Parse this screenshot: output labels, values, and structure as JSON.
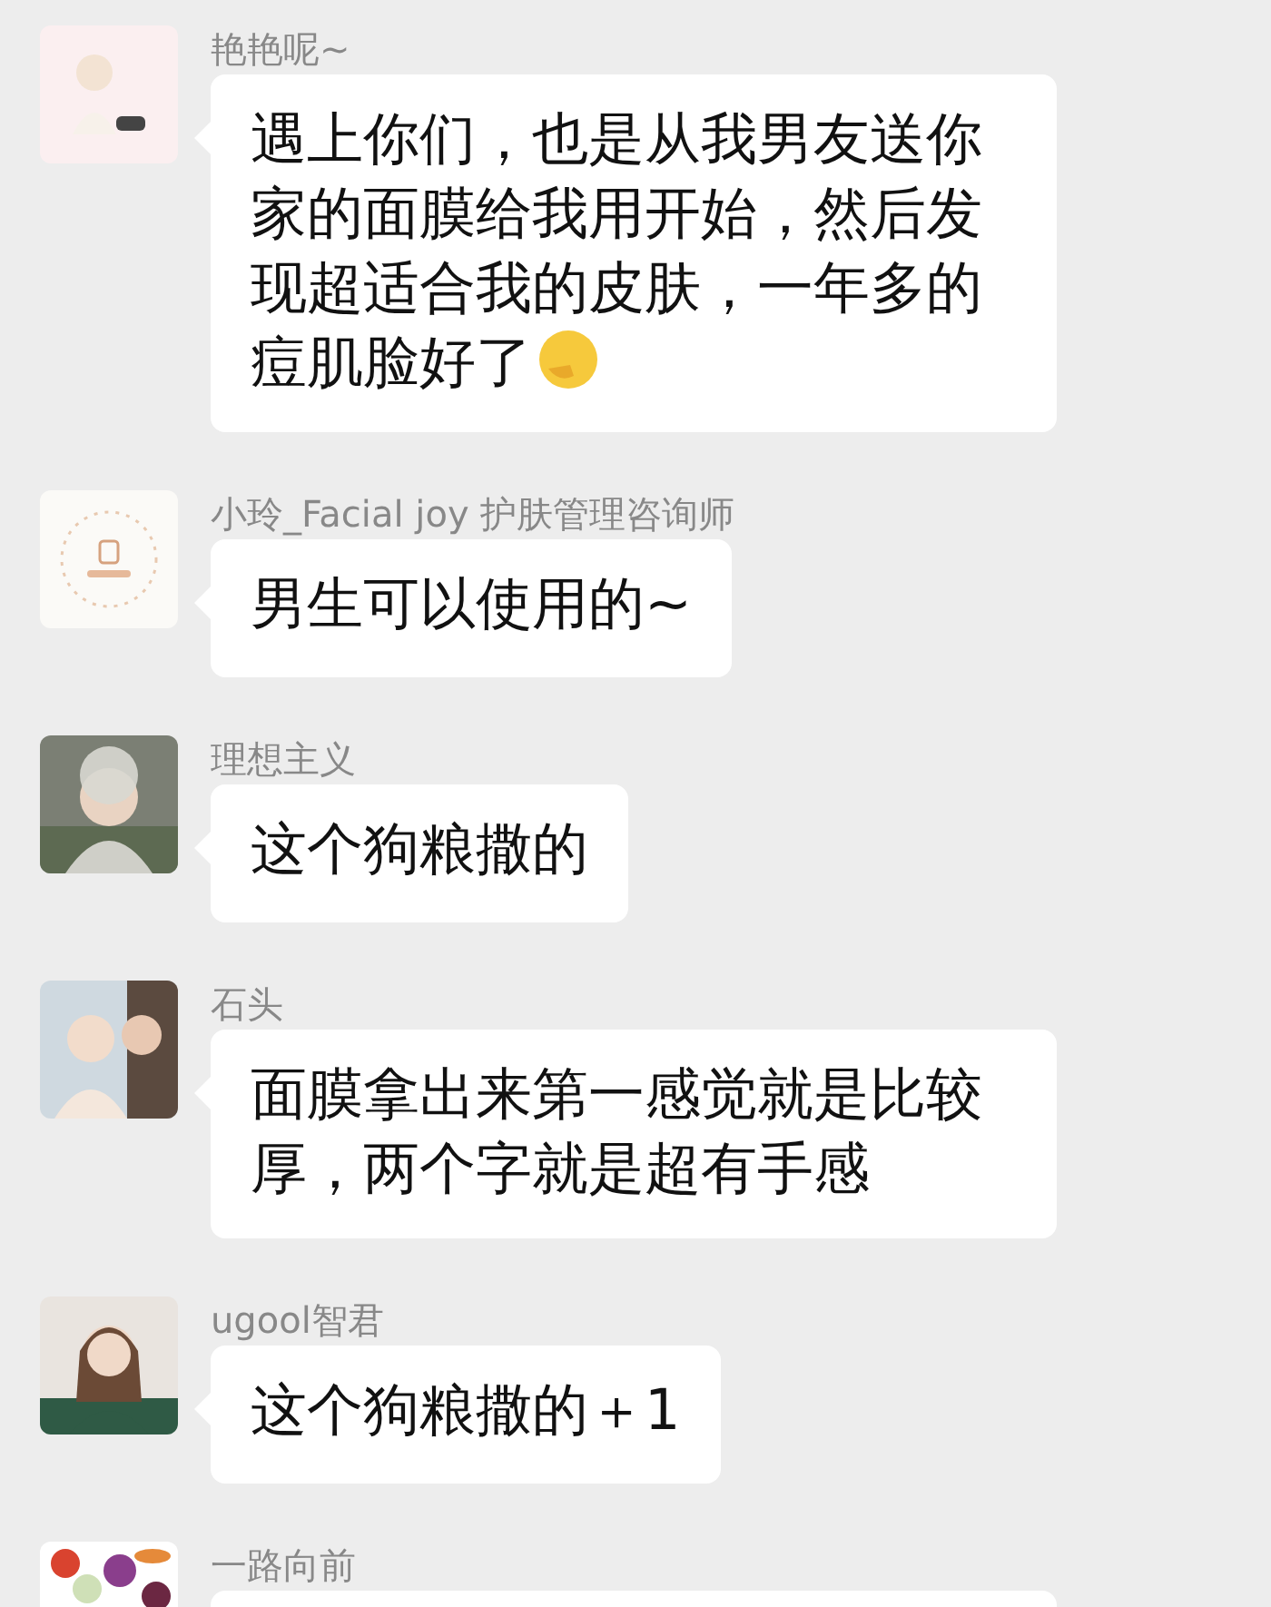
{
  "messages": [
    {
      "sender": "艳艳呢~",
      "text": "遇上你们，也是从我男友送你家的面膜给我用开始，然后发现超适合我的皮肤，一年多的痘肌脸好了",
      "trailing_emoji": true
    },
    {
      "sender": "小玲_Facial joy 护肤管理咨询师",
      "text": "男生可以使用的~"
    },
    {
      "sender": "理想主义",
      "text": "这个狗粮撒的"
    },
    {
      "sender": "石头",
      "text": "面膜拿出来第一感觉就是比较厚，两个字就是超有手感"
    },
    {
      "sender": "ugool智君",
      "text": "这个狗粮撒的＋1"
    },
    {
      "sender": "一路向前"
    }
  ]
}
